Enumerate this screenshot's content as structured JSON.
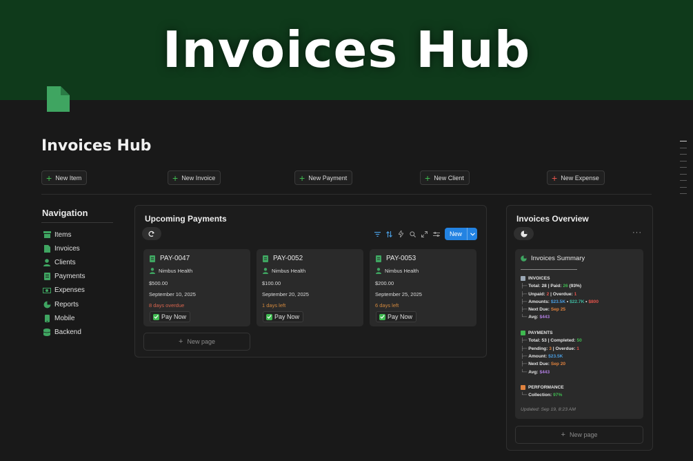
{
  "banner": {
    "title": "Invoices Hub"
  },
  "page": {
    "title": "Invoices Hub"
  },
  "quick_actions": [
    {
      "label": "New Item",
      "color": "#3fb950"
    },
    {
      "label": "New Invoice",
      "color": "#3fb950"
    },
    {
      "label": "New Payment",
      "color": "#3fb950"
    },
    {
      "label": "New Client",
      "color": "#3fb950"
    },
    {
      "label": "New Expense",
      "color": "#e5534b"
    }
  ],
  "navigation": {
    "title": "Navigation",
    "items": [
      {
        "label": "Items",
        "icon": "box-icon"
      },
      {
        "label": "Invoices",
        "icon": "document-icon"
      },
      {
        "label": "Clients",
        "icon": "person-icon"
      },
      {
        "label": "Payments",
        "icon": "receipt-icon"
      },
      {
        "label": "Expenses",
        "icon": "money-icon"
      },
      {
        "label": "Reports",
        "icon": "pie-chart-icon"
      },
      {
        "label": "Mobile",
        "icon": "phone-icon"
      },
      {
        "label": "Backend",
        "icon": "database-icon"
      }
    ]
  },
  "upcoming": {
    "title": "Upcoming Payments",
    "new_label": "New",
    "new_page_label": "New page",
    "cards": [
      {
        "id": "PAY-0047",
        "client": "Nimbus Health",
        "amount": "$500.00",
        "date": "September 10, 2025",
        "status": "8 days overdue",
        "status_color": "#d8644e",
        "action": "Pay Now"
      },
      {
        "id": "PAY-0052",
        "client": "Nimbus Health",
        "amount": "$100.00",
        "date": "September 20, 2025",
        "status": "1 days left",
        "status_color": "#d3893e",
        "action": "Pay Now"
      },
      {
        "id": "PAY-0053",
        "client": "Nimbus Health",
        "amount": "$200.00",
        "date": "September 25, 2025",
        "status": "6 days left",
        "status_color": "#d3893e",
        "action": "Pay Now"
      }
    ]
  },
  "overview": {
    "title": "Invoices Overview",
    "more": "···",
    "new_page_label": "New page",
    "summary": {
      "title": "Invoices Summary",
      "invoices": {
        "head": "INVOICES",
        "total_label": "Total:",
        "total": "28",
        "paid_label": "| Paid:",
        "paid": "26",
        "paid_pct": "(93%)",
        "unpaid_label": "Unpaid:",
        "unpaid": "2",
        "overdue_label": "| Overdue:",
        "overdue": "1",
        "amounts_label": "Amounts:",
        "amount_a": "$23.5K",
        "amount_b": "$22.7K",
        "amount_c": "$800",
        "next_label": "Next Due:",
        "next": "Sep 25",
        "avg_label": "Avg:",
        "avg": "$443"
      },
      "payments": {
        "head": "PAYMENTS",
        "total_label": "Total:",
        "total": "53",
        "completed_label": "| Completed:",
        "completed": "50",
        "pending_label": "Pending:",
        "pending": "3",
        "overdue_label": "| Overdue:",
        "overdue": "1",
        "amount_label": "Amount:",
        "amount": "$23.5K",
        "next_label": "Next Due:",
        "next": "Sep 20",
        "avg_label": "Avg:",
        "avg": "$443"
      },
      "performance": {
        "head": "PERFORMANCE",
        "collection_label": "Collection:",
        "collection": "97%"
      },
      "updated": "Updated: Sep 19, 8:23 AM"
    }
  },
  "colors": {
    "accent_green": "#3fb950",
    "accent_blue": "#2383e2",
    "banner": "#0f3a1b"
  }
}
